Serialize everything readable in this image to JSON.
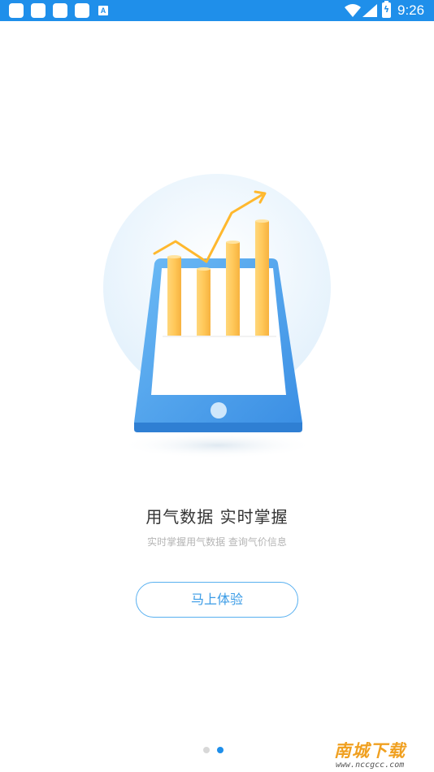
{
  "status_bar": {
    "time": "9:26",
    "notification_icons": [
      "app-notification-icon",
      "app-notification-icon",
      "app-notification-icon",
      "app-notification-icon",
      "accessibility-a-icon"
    ],
    "indicators": [
      "wifi-icon",
      "cell-signal-icon",
      "battery-charging-icon"
    ],
    "a_badge": "A",
    "battery_glyph": "ϟ",
    "color": "#1f8fea"
  },
  "onboarding": {
    "title": "用气数据  实时掌握",
    "subtitle": "实时掌握用气数据  查询气价信息",
    "cta_label": "马上体验",
    "page_indicator": {
      "total": 2,
      "current": 2
    }
  },
  "illustration": {
    "subject": "tablet-with-bar-chart",
    "colors": {
      "circle": "#e8f4fd",
      "tablet": "#4aa3ef",
      "bars": "#ffc85a",
      "arrow": "#ffb82e"
    }
  },
  "watermark": {
    "name": "南城下载",
    "url": "www.nccgcc.com"
  }
}
